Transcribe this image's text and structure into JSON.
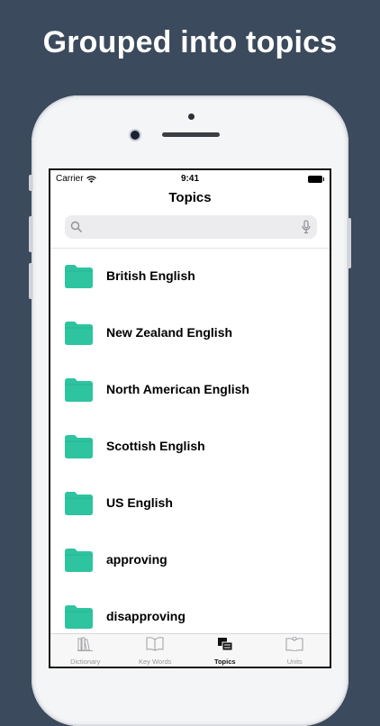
{
  "headline": "Grouped into topics",
  "status_bar": {
    "carrier": "Carrier",
    "time": "9:41"
  },
  "nav": {
    "title": "Topics"
  },
  "search": {
    "value": "",
    "placeholder": ""
  },
  "topics": [
    {
      "label": "British English"
    },
    {
      "label": "New Zealand English"
    },
    {
      "label": "North American English"
    },
    {
      "label": "Scottish English"
    },
    {
      "label": "US English"
    },
    {
      "label": "approving"
    },
    {
      "label": "disapproving"
    }
  ],
  "tabs": [
    {
      "label": "Dictionary",
      "icon": "books-icon",
      "active": false
    },
    {
      "label": "Key Words",
      "icon": "open-book-icon",
      "active": false
    },
    {
      "label": "Topics",
      "icon": "topics-icon",
      "active": true
    },
    {
      "label": "Units",
      "icon": "units-book-icon",
      "active": false
    }
  ],
  "colors": {
    "background": "#3b4a5c",
    "folder": "#2ec4a0",
    "tab_active": "#111111",
    "tab_inactive": "#9a9a9e"
  }
}
